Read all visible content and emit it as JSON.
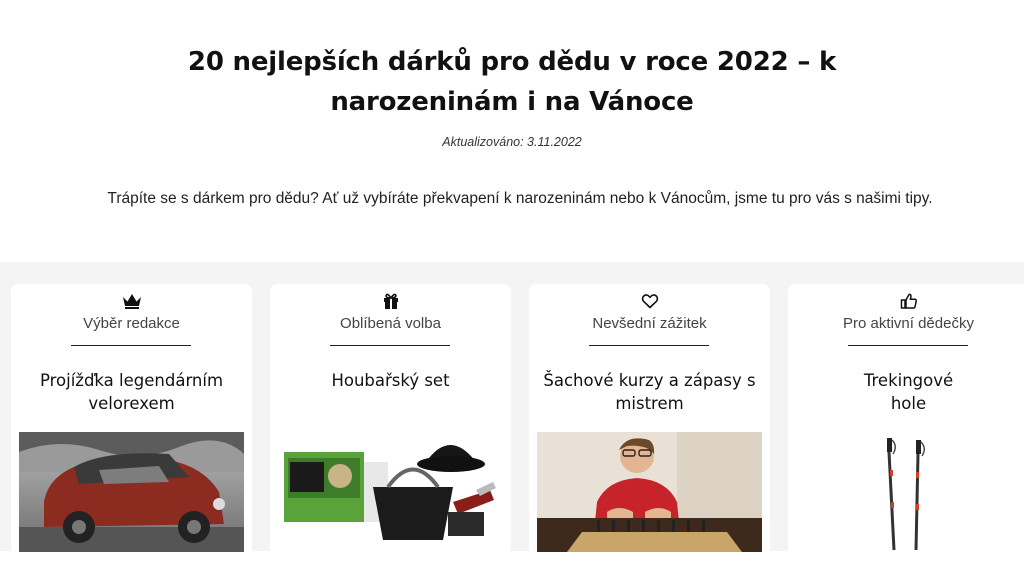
{
  "article": {
    "title": "20 nejlepších dárků pro dědu v roce 2022 – k narozeninám i na Vánoce",
    "updated": "Aktualizováno: 3.11.2022",
    "intro": "Trápíte se s dárkem pro dědu? Ať už vybíráte překvapení k narozeninám nebo k Vánocům, jsme tu pro vás s našimi tipy."
  },
  "cards": [
    {
      "icon": "crown-icon",
      "category": "Výběr redakce",
      "name": "Projížďka legendárním velorexem",
      "image": "velorex-car-image"
    },
    {
      "icon": "gift-icon",
      "category": "Oblíbená volba",
      "name": "Houbařský set",
      "image": "mushroom-picking-set-image"
    },
    {
      "icon": "heart-icon",
      "category": "Nevšední zážitek",
      "name": "Šachové kurzy a zápasy s mistrem",
      "image": "chess-master-image"
    },
    {
      "icon": "thumbs-up-icon",
      "category": "Pro aktivní dědečky",
      "name": "Trekingové hole",
      "image": "trekking-poles-image"
    }
  ]
}
